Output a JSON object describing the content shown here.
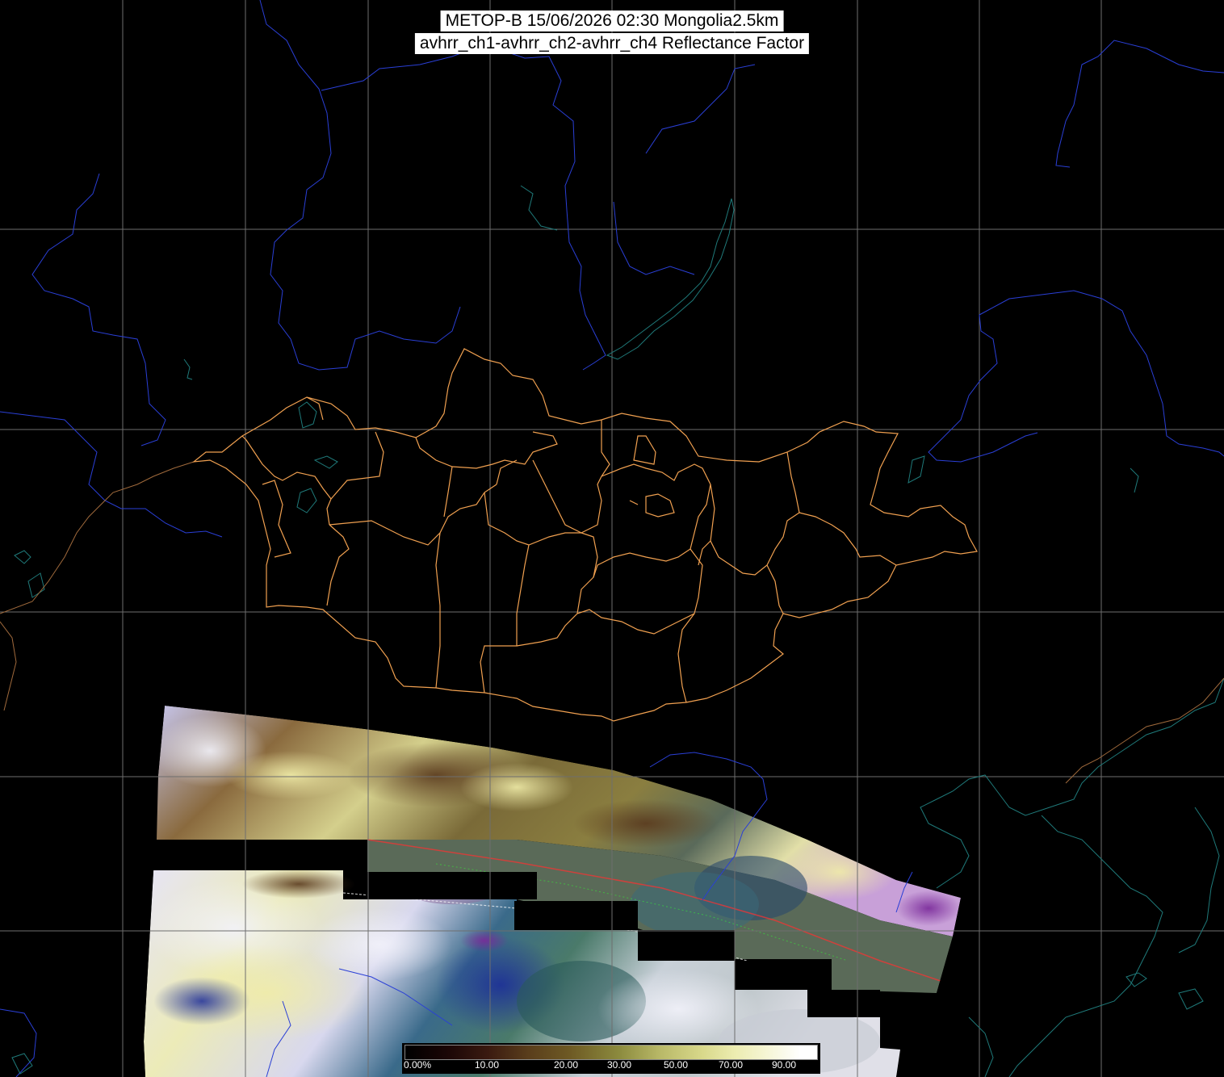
{
  "header": {
    "line1": "METOP-B 15/06/2026 02:30 Mongolia2.5km",
    "line2": "avhrr_ch1-avhrr_ch2-avhrr_ch4 Reflectance Factor"
  },
  "colorbar": {
    "ticks": [
      "0.00%",
      "10.00",
      "20.00",
      "30.00",
      "50.00",
      "70.00",
      "90.00"
    ]
  },
  "colors": {
    "background": "#000000",
    "graticule": "#6e6e6e",
    "river": "#2a3fd6",
    "coastline_lake": "#1f7a7a",
    "admin_boundary": "#f0a050",
    "country_boundary": "#a06a3c",
    "title_background": "#ffffff"
  },
  "icons": {
    "swath": "satellite-swath-image",
    "legend": "reflectance-colorbar"
  }
}
